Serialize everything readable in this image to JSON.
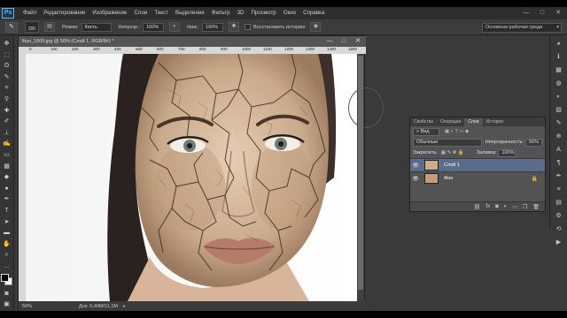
{
  "app": {
    "logo": "Ps",
    "menu": [
      "Файл",
      "Редактирование",
      "Изображение",
      "Слои",
      "Текст",
      "Выделение",
      "Фильтр",
      "3D",
      "Просмотр",
      "Окно",
      "Справка"
    ],
    "window_controls": [
      "—",
      "□",
      "✕"
    ]
  },
  "options": {
    "brush_size": "200",
    "mode_label": "Режим:",
    "mode_value": "Кисть",
    "opacity_label": "Непрозр.:",
    "opacity_value": "100%",
    "pressure_label": "Наж.:",
    "pressure_value": "100%",
    "history_label": "Восстановить историю",
    "workspace": "Основная рабочая среда"
  },
  "document": {
    "tab_title": "lituo_1600.jpg @ 50% (Слой 1, RGB/8#) *",
    "ruler_ticks": [
      "0",
      "100",
      "200",
      "300",
      "400",
      "500",
      "600",
      "700",
      "800",
      "900",
      "1000",
      "1100",
      "1200",
      "1300",
      "1400",
      "1500"
    ],
    "status_zoom": "50%",
    "status_doc": "Док: 5,49M/11,1M"
  },
  "layers_panel": {
    "tabs": [
      "Свойства",
      "Операции",
      "Слои",
      "История"
    ],
    "active_tab": "Слои",
    "filter_kind": "Вид",
    "blend_mode": "Обычные",
    "opacity_label": "Непрозрачность:",
    "opacity_value": "50%",
    "lock_label": "Закрепить:",
    "fill_label": "Заливка:",
    "fill_value": "100%",
    "layers": [
      {
        "name": "Слой 1",
        "selected": true
      },
      {
        "name": "Фон",
        "selected": false
      }
    ],
    "bottom_icons": [
      "link-icon",
      "fx-icon",
      "mask-icon",
      "adjustment-icon",
      "folder-icon",
      "new-layer-icon",
      "trash-icon"
    ]
  }
}
